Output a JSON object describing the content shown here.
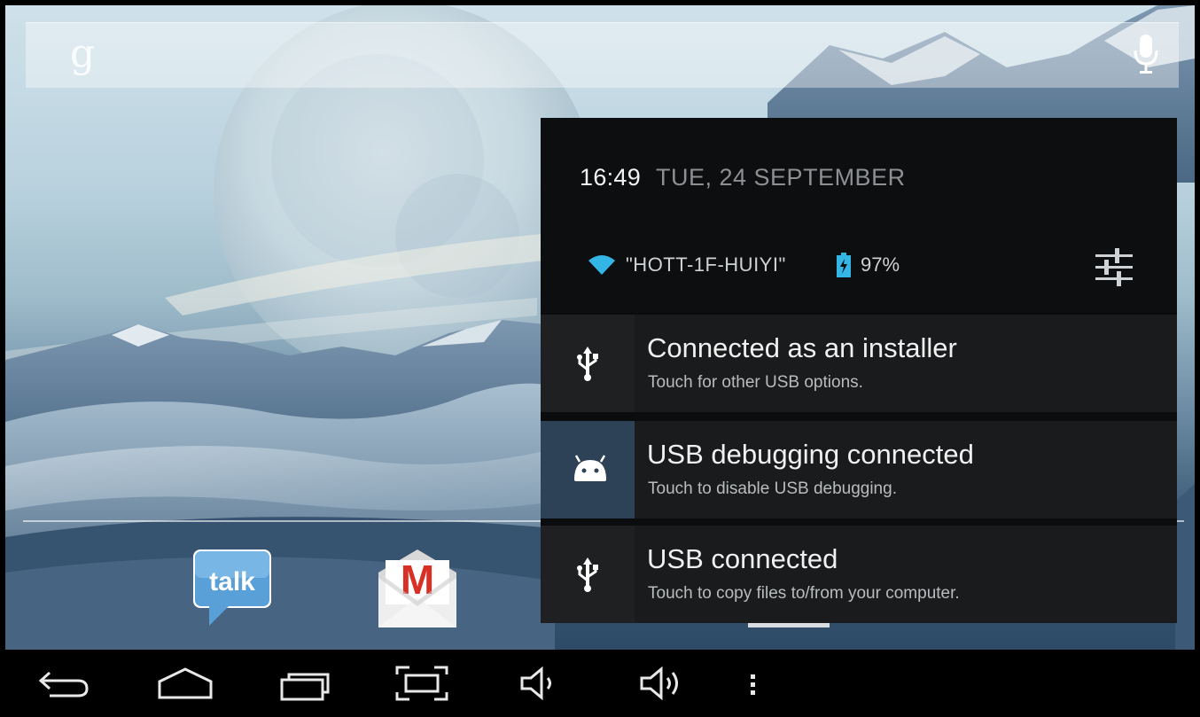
{
  "search": {
    "logo_letter": "g"
  },
  "shade": {
    "time": "16:49",
    "date": "TUE, 24 SEPTEMBER",
    "wifi_ssid": "\"HOTT-1F-HUIYI\"",
    "battery": "97%",
    "notifications": [
      {
        "icon": "usb-icon",
        "title": "Connected as an installer",
        "subtitle": "Touch for other USB options."
      },
      {
        "icon": "android-debug-icon",
        "title": "USB debugging connected",
        "subtitle": "Touch to disable USB debugging."
      },
      {
        "icon": "usb-icon",
        "title": "USB connected",
        "subtitle": "Touch to copy files to/from your computer."
      }
    ]
  },
  "dock": {
    "apps": [
      {
        "name": "talk",
        "label": "talk"
      },
      {
        "name": "gmail",
        "label": "M"
      }
    ]
  },
  "navbar": {
    "buttons": [
      "back-icon",
      "home-icon",
      "recent-apps-icon",
      "screenshot-icon",
      "volume-down-icon",
      "volume-up-icon",
      "menu-icon"
    ]
  },
  "colors": {
    "shade_bg": "#0b0c0d",
    "notif_bg": "#1a1b1c",
    "debug_icon_bg": "#2d4256",
    "wifi": "#33b5e5"
  }
}
